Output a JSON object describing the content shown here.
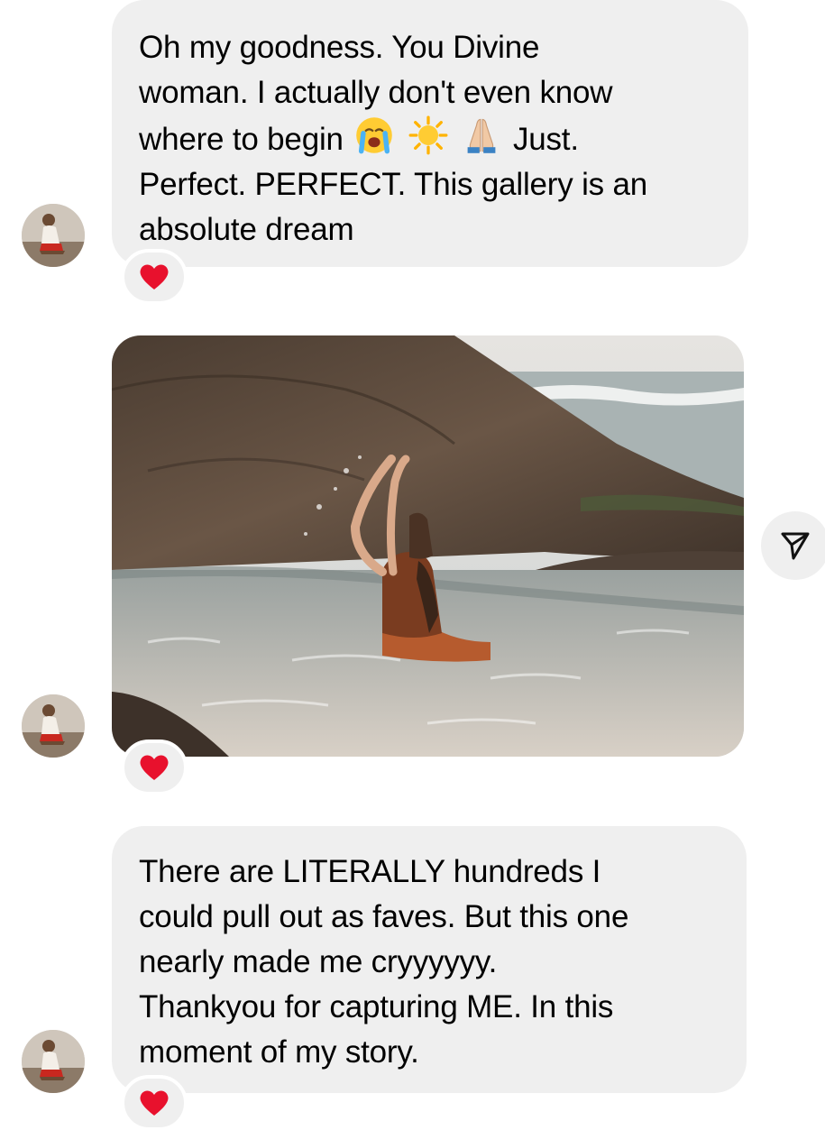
{
  "colors": {
    "bubble_bg": "#efefef",
    "heart": "#e8112d",
    "background": "#ffffff"
  },
  "messages": [
    {
      "type": "text",
      "lines": [
        "Oh my goodness. You Divine",
        "woman. I actually don't even know",
        "where to begin",
        "Just.",
        "Perfect. PERFECT. This gallery is an",
        "absolute dream"
      ],
      "emojis": [
        "loudly-crying-face-icon",
        "sun-icon",
        "folded-hands-icon"
      ],
      "reaction": "red-heart-icon"
    },
    {
      "type": "photo",
      "photo_subject": "woman-in-sea-pool-photo",
      "reaction": "red-heart-icon",
      "share_icon": "paper-plane-icon"
    },
    {
      "type": "text",
      "lines": [
        "There are LITERALLY hundreds I",
        "could pull out as faves. But this one",
        "nearly made me cryyyyyy.",
        "Thankyou for capturing ME. In this",
        "moment of my story."
      ],
      "reaction": "red-heart-icon"
    }
  ]
}
